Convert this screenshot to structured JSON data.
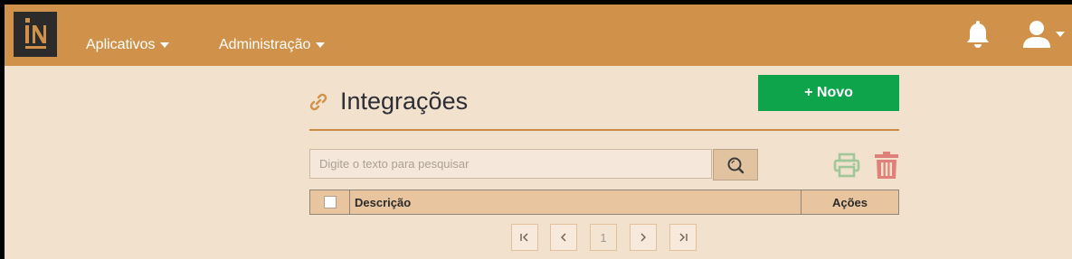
{
  "navbar": {
    "logo_text": "IN",
    "menus": [
      {
        "label": "Aplicativos"
      },
      {
        "label": "Administração"
      }
    ]
  },
  "page": {
    "title": "Integrações",
    "new_button_label": "+ Novo"
  },
  "search": {
    "placeholder": "Digite o texto para pesquisar",
    "value": ""
  },
  "table": {
    "columns": [
      "Descrição",
      "Ações"
    ],
    "rows": []
  },
  "pagination": {
    "current_page": "1"
  },
  "colors": {
    "navbar": "#d0924a",
    "background": "#f2e1cd",
    "new_button": "#0ea44b",
    "print_icon": "#9fc79a",
    "trash_icon": "#e0807a"
  },
  "icons": [
    "logo-icon",
    "bell-icon",
    "user-icon",
    "link-icon",
    "search-icon",
    "printer-icon",
    "trash-icon",
    "first-page-icon",
    "prev-page-icon",
    "next-page-icon",
    "last-page-icon"
  ]
}
